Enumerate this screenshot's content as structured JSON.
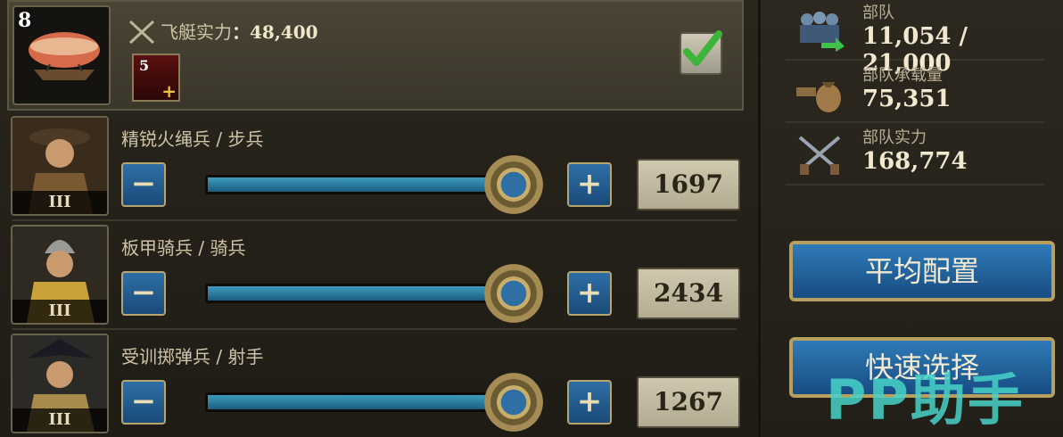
{
  "airship": {
    "level": "8",
    "power_label": "飞艇实力",
    "power_sep": "：",
    "power_value": "48,400",
    "item_count": "5",
    "item_plus": "+",
    "selected": true
  },
  "units": [
    {
      "name": "精锐火绳兵 / 步兵",
      "tier": "III",
      "count": "1697",
      "slider_fraction": 0.96
    },
    {
      "name": "板甲骑兵 / 骑兵",
      "tier": "III",
      "count": "2434",
      "slider_fraction": 0.96
    },
    {
      "name": "受训掷弹兵 / 射手",
      "tier": "III",
      "count": "1267",
      "slider_fraction": 0.96
    }
  ],
  "stepper": {
    "minus": "−",
    "plus": "+"
  },
  "stats": [
    {
      "label": "部队",
      "value": "11,054 / 21,000",
      "icon": "troops-icon"
    },
    {
      "label": "部队承载量",
      "value": "75,351",
      "icon": "cargo-bag-icon"
    },
    {
      "label": "部队实力",
      "value": "168,774",
      "icon": "crossed-pistols-icon"
    }
  ],
  "buttons": {
    "average": "平均配置",
    "quick_select": "快速选择"
  },
  "watermark": "PP助手",
  "colors": {
    "button_blue": "#2f7bb7",
    "gold_border": "#b79f5f",
    "check_green": "#3fb43a"
  }
}
